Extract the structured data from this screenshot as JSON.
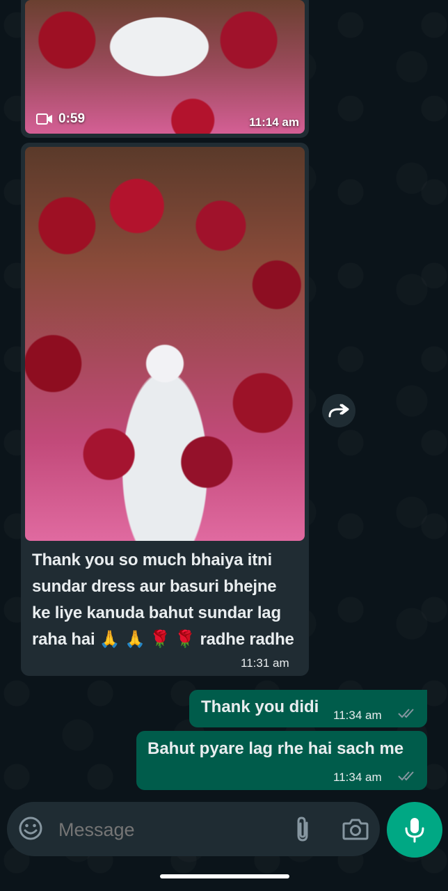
{
  "messages": {
    "video": {
      "duration": "0:59",
      "time": "11:14 am"
    },
    "photo": {
      "caption": "Thank you so much bhaiya itni sundar dress aur basuri  bhejne ke liye kanuda bahut sundar lag raha hai 🙏 🙏 🌹 🌹  radhe radhe",
      "time": "11:31 am"
    },
    "out1": {
      "text": "Thank you didi",
      "time": "11:34 am"
    },
    "out2": {
      "text": "Bahut pyare lag rhe hai sach me",
      "time": "11:34 am"
    }
  },
  "composer": {
    "placeholder": "Message"
  },
  "icons": {
    "video": "video-camera-icon",
    "share": "forward-icon",
    "ticks": "double-check-icon",
    "emoji": "emoji-icon",
    "attach": "paperclip-icon",
    "camera": "camera-icon",
    "mic": "microphone-icon"
  },
  "colors": {
    "background": "#0b141a",
    "incoming_bubble": "#202c33",
    "outgoing_bubble": "#005c4b",
    "accent": "#00a884",
    "read_ticks": "#8696a0"
  }
}
